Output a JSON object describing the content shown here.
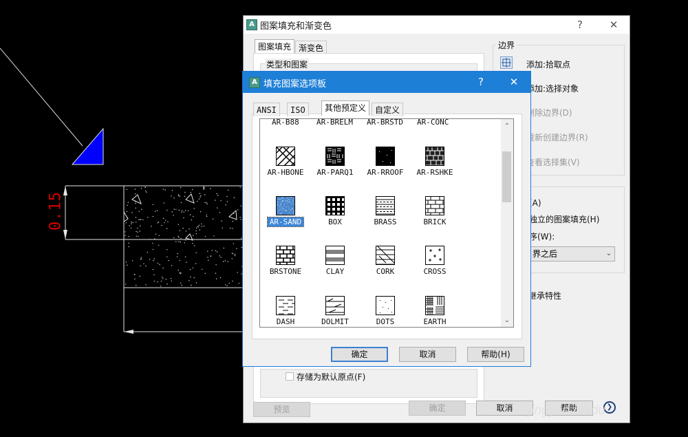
{
  "cad": {
    "dimension_text": "0.15"
  },
  "back_dialog": {
    "title": "图案填充和渐变色",
    "help_symbol": "?",
    "close_symbol": "✕",
    "tabs": [
      "图案填充",
      "渐变色"
    ],
    "type_and_pattern_label": "类型和图案",
    "boundary_label": "边界",
    "add_pick_points": "添加:拾取点",
    "add_select_objects": "添加:选择对象",
    "remove_boundaries": "删除边界(D)",
    "recreate_boundary": "重新创建边界(R)",
    "view_selections": "查看选择集(V)",
    "options_annotative": "(A)",
    "options_separate": "独立的图案填充(H)",
    "draw_order_label": "序(W):",
    "draw_order_value": "界之后",
    "inherit_properties": "继承特性",
    "store_default_origin": "存储为默认原点(F)",
    "preview_button": "预览",
    "ok_button": "确定",
    "cancel_button": "取消",
    "help_button": "帮助"
  },
  "front_dialog": {
    "title": "填充图案选项板",
    "help_symbol": "?",
    "close_symbol": "✕",
    "tabs": [
      "ANSI",
      "ISO",
      "其他预定义",
      "自定义"
    ],
    "active_tab": "其他预定义",
    "partial_row": [
      "AR-B88",
      "AR-BRELM",
      "AR-BRSTD",
      "AR-CONC"
    ],
    "patterns": [
      {
        "name": "AR-HBONE",
        "icon": "herringbone-pattern-icon"
      },
      {
        "name": "AR-PARQ1",
        "icon": "parquet-pattern-icon"
      },
      {
        "name": "AR-RROOF",
        "icon": "roof-pattern-icon"
      },
      {
        "name": "AR-RSHKE",
        "icon": "shake-pattern-icon"
      },
      {
        "name": "AR-SAND",
        "icon": "sand-pattern-icon",
        "selected": true
      },
      {
        "name": "BOX",
        "icon": "box-pattern-icon"
      },
      {
        "name": "BRASS",
        "icon": "brass-pattern-icon"
      },
      {
        "name": "BRICK",
        "icon": "brick-pattern-icon"
      },
      {
        "name": "BRSTONE",
        "icon": "brstone-pattern-icon"
      },
      {
        "name": "CLAY",
        "icon": "clay-pattern-icon"
      },
      {
        "name": "CORK",
        "icon": "cork-pattern-icon"
      },
      {
        "name": "CROSS",
        "icon": "cross-pattern-icon"
      },
      {
        "name": "DASH",
        "icon": "dash-pattern-icon"
      },
      {
        "name": "DOLMIT",
        "icon": "dolmit-pattern-icon"
      },
      {
        "name": "DOTS",
        "icon": "dots-pattern-icon"
      },
      {
        "name": "EARTH",
        "icon": "earth-pattern-icon"
      }
    ],
    "ok_button": "确定",
    "cancel_button": "取消",
    "help_button": "帮助(H)"
  },
  "watermark": "jingyan.baidu",
  "colors": {
    "title_blue": "#1e7fd6",
    "selection_blue": "#3a86d8",
    "cad_blue_triangle": "#0000ff",
    "dimension_red": "#d40000"
  }
}
